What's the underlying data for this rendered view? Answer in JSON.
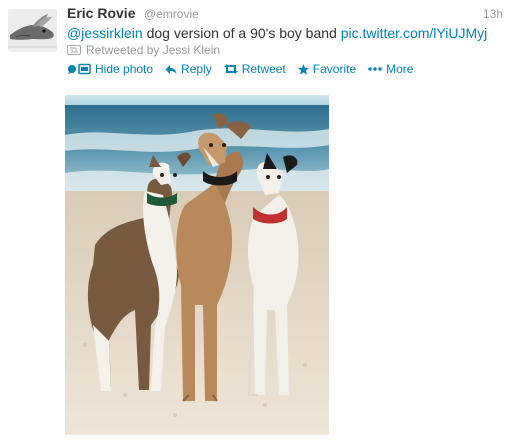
{
  "tweet": {
    "author_name": "Eric Rovie",
    "author_handle": "@emrovie",
    "time": "13h",
    "mention": "@jessirklein",
    "text_body": " dog version of a 90's boy band ",
    "link": "pic.twitter.com/lYiUJMyj",
    "retweeted_by": "Retweeted by Jessi Klein"
  },
  "actions": {
    "hide_photo": "Hide photo",
    "reply": "Reply",
    "retweet": "Retweet",
    "favorite": "Favorite",
    "more": "More"
  },
  "colors": {
    "link": "#0084b4",
    "muted": "#999999",
    "text": "#333333"
  },
  "icons": [
    "avatar-image",
    "retweet-icon",
    "photo-icon",
    "reply-icon",
    "star-icon",
    "more-icon"
  ]
}
